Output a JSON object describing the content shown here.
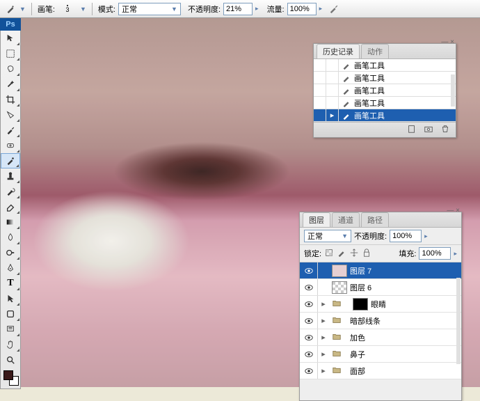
{
  "optionsBar": {
    "brushLabel": "画笔:",
    "brushSize": "3",
    "modeLabel": "模式:",
    "modeValue": "正常",
    "opacityLabel": "不透明度:",
    "opacityValue": "21%",
    "flowLabel": "流量:",
    "flowValue": "100%"
  },
  "app": {
    "logo": "Ps"
  },
  "tools": [
    "move",
    "marquee",
    "lasso",
    "magic-wand",
    "crop",
    "slice",
    "eyedropper",
    "healing",
    "brush",
    "stamp",
    "history-brush",
    "eraser",
    "gradient",
    "blur",
    "dodge",
    "pen",
    "type",
    "path-select",
    "shape",
    "notes",
    "hand",
    "zoom"
  ],
  "historyPanel": {
    "tabs": [
      "历史记录",
      "动作"
    ],
    "items": [
      "画笔工具",
      "画笔工具",
      "画笔工具",
      "画笔工具",
      "画笔工具"
    ],
    "selectedIndex": 4
  },
  "layersPanel": {
    "tabs": [
      "图层",
      "通道",
      "路径"
    ],
    "blendLabel": "正常",
    "opacityLabel": "不透明度:",
    "opacityValue": "100%",
    "lockLabel": "锁定:",
    "fillLabel": "填充:",
    "fillValue": "100%",
    "layers": [
      {
        "name": "图层 7",
        "kind": "layer",
        "sel": true
      },
      {
        "name": "图层 6",
        "kind": "layer",
        "sel": false
      },
      {
        "name": "眼睛",
        "kind": "group-mask",
        "sel": false
      },
      {
        "name": "暗部线条",
        "kind": "group",
        "sel": false
      },
      {
        "name": "加色",
        "kind": "group",
        "sel": false
      },
      {
        "name": "鼻子",
        "kind": "group",
        "sel": false
      },
      {
        "name": "面部",
        "kind": "group",
        "sel": false
      }
    ]
  }
}
